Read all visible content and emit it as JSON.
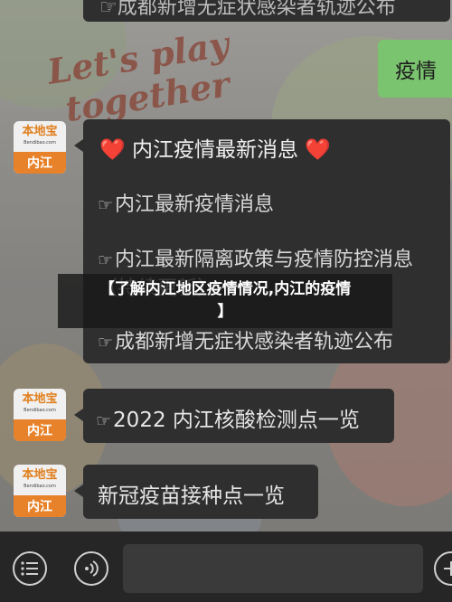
{
  "chat": {
    "top_bubble_text": "☞成都新增无症状感染者轨迹公布",
    "user_reply": "疫情",
    "bot_avatar": {
      "logo": "本地宝",
      "url": "Bendibao.com",
      "city": "内江"
    },
    "main_message": {
      "title": "内江疫情最新消息",
      "heart_left": "❤️",
      "heart_right": "❤️",
      "hand": "☞",
      "links": [
        "内江最新疫情消息",
        "内江最新隔离政策与疫情防控消息（持续更新）",
        "成都新增无症状感染者轨迹公布"
      ]
    },
    "bubble_2022": {
      "hand": "☞",
      "text": "2022 内江核酸检测点一览"
    },
    "bubble_vaccine": {
      "text": "新冠疫苗接种点一览"
    }
  },
  "wallpaper": {
    "text": "Let's play\n together"
  },
  "banner": {
    "line1": "【了解内江地区疫情情况,内江的疫情",
    "line2": "】"
  },
  "bottom_bar": {
    "menu_icon": "menu-list-icon",
    "voice_icon": "voice-icon",
    "add_icon": "add-icon"
  },
  "colors": {
    "accent_green": "#7bc46f",
    "brand_orange": "#e8822a",
    "heart_red": "#e0353f"
  }
}
